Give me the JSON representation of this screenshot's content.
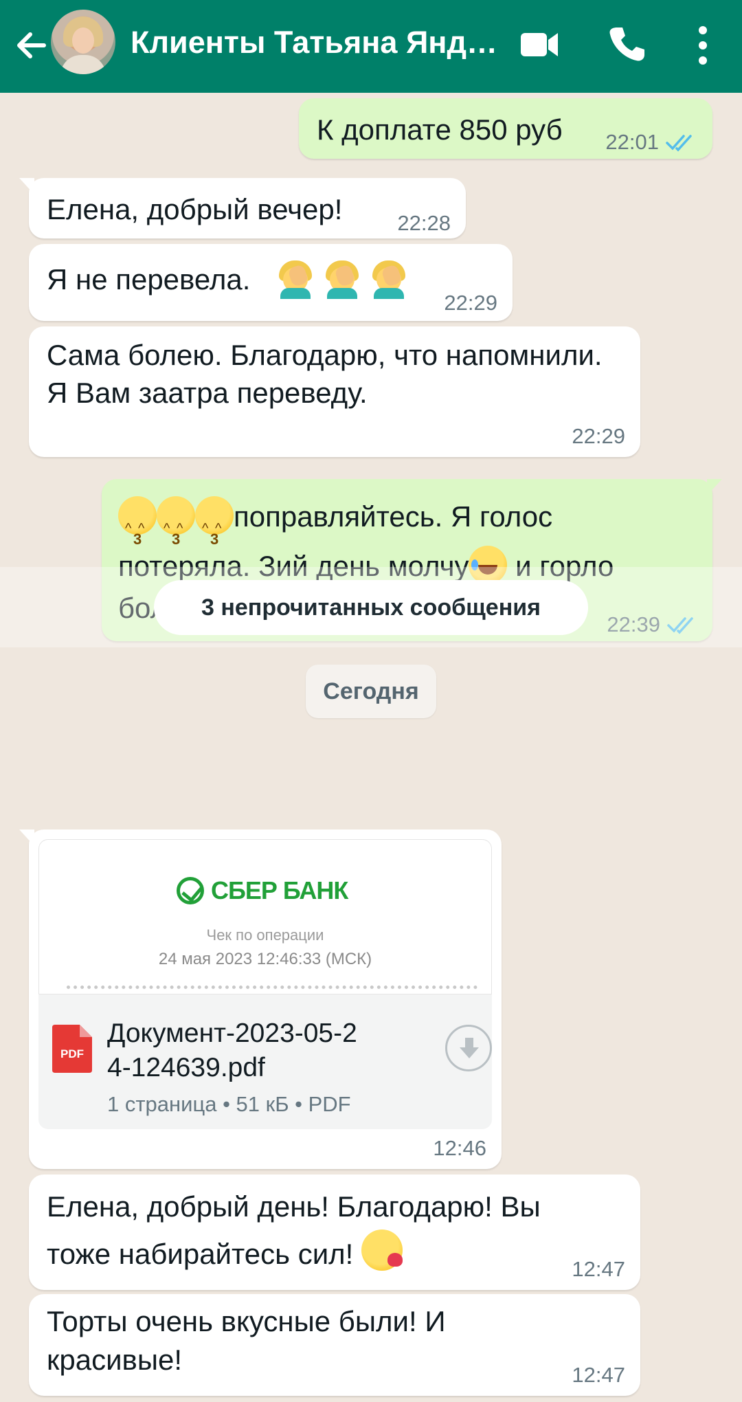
{
  "header": {
    "title": "Клиенты Татьяна Янд…",
    "bg_color": "#008069",
    "icons": [
      "back-arrow-icon",
      "avatar",
      "video-call-icon",
      "phone-icon",
      "more-options-icon"
    ]
  },
  "messages": {
    "m1": {
      "text": "К доплате 850 руб",
      "time": "22:01",
      "status": "read"
    },
    "m2": {
      "text": "Елена, добрый вечер!",
      "time": "22:28"
    },
    "m3": {
      "text": "Я не перевела.",
      "time": "22:29",
      "emoji": [
        "facepalm",
        "facepalm",
        "facepalm"
      ]
    },
    "m4": {
      "text": "Сама болею. Благодарю, что напомнили. Я Вам заатра переведу.",
      "time": "22:29"
    },
    "m5": {
      "emoji_start": [
        "kissing-face",
        "kissing-face",
        "kissing-face"
      ],
      "part1": "поправляйтесь. Я голос",
      "part2": "потеряла. Зий день молчу",
      "part2_emoji": "tears-of-joy-face",
      "part3": " и горло",
      "part4": "болит ужасно.",
      "time": "22:39",
      "status": "read"
    },
    "unread": "3 непрочитанных сообщения",
    "date": "Сегодня",
    "doc": {
      "bank": "СБЕР БАНК",
      "receipt_title": "Чек по операции",
      "receipt_date": "24 мая 2023 12:46:33 (МСК)",
      "file_icon": "PDF",
      "file_line1": "Документ-2023-05-2",
      "file_line2": "4-124639.pdf",
      "meta": "1 страница • 51 кБ • PDF",
      "time": "12:46"
    },
    "m6": {
      "line1": "Елена, добрый день! Благодарю! Вы",
      "line2": "тоже набирайтесь сил!",
      "time": "12:47",
      "emoji": "face-blowing-kiss"
    },
    "m7": {
      "line1": "Торты очень вкусные были! И",
      "line2": "красивые!",
      "time": "12:47"
    }
  },
  "colors": {
    "outgoing": "#dcf8c6",
    "incoming": "#ffffff",
    "background": "#efe7de",
    "read_ticks": "#53bdeb",
    "sber_green": "#21a038"
  }
}
